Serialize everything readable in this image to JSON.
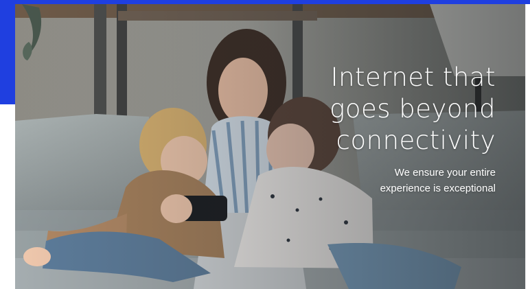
{
  "hero": {
    "title": "Internet that goes beyond connectivity",
    "subtitle_line1": "We ensure your entire",
    "subtitle_line2": "experience is exceptional",
    "image_icon": "family-photo-icon"
  },
  "colors": {
    "brand_blue": "#1f3fe0",
    "text_white": "#ffffff",
    "background": "#ffffff"
  }
}
